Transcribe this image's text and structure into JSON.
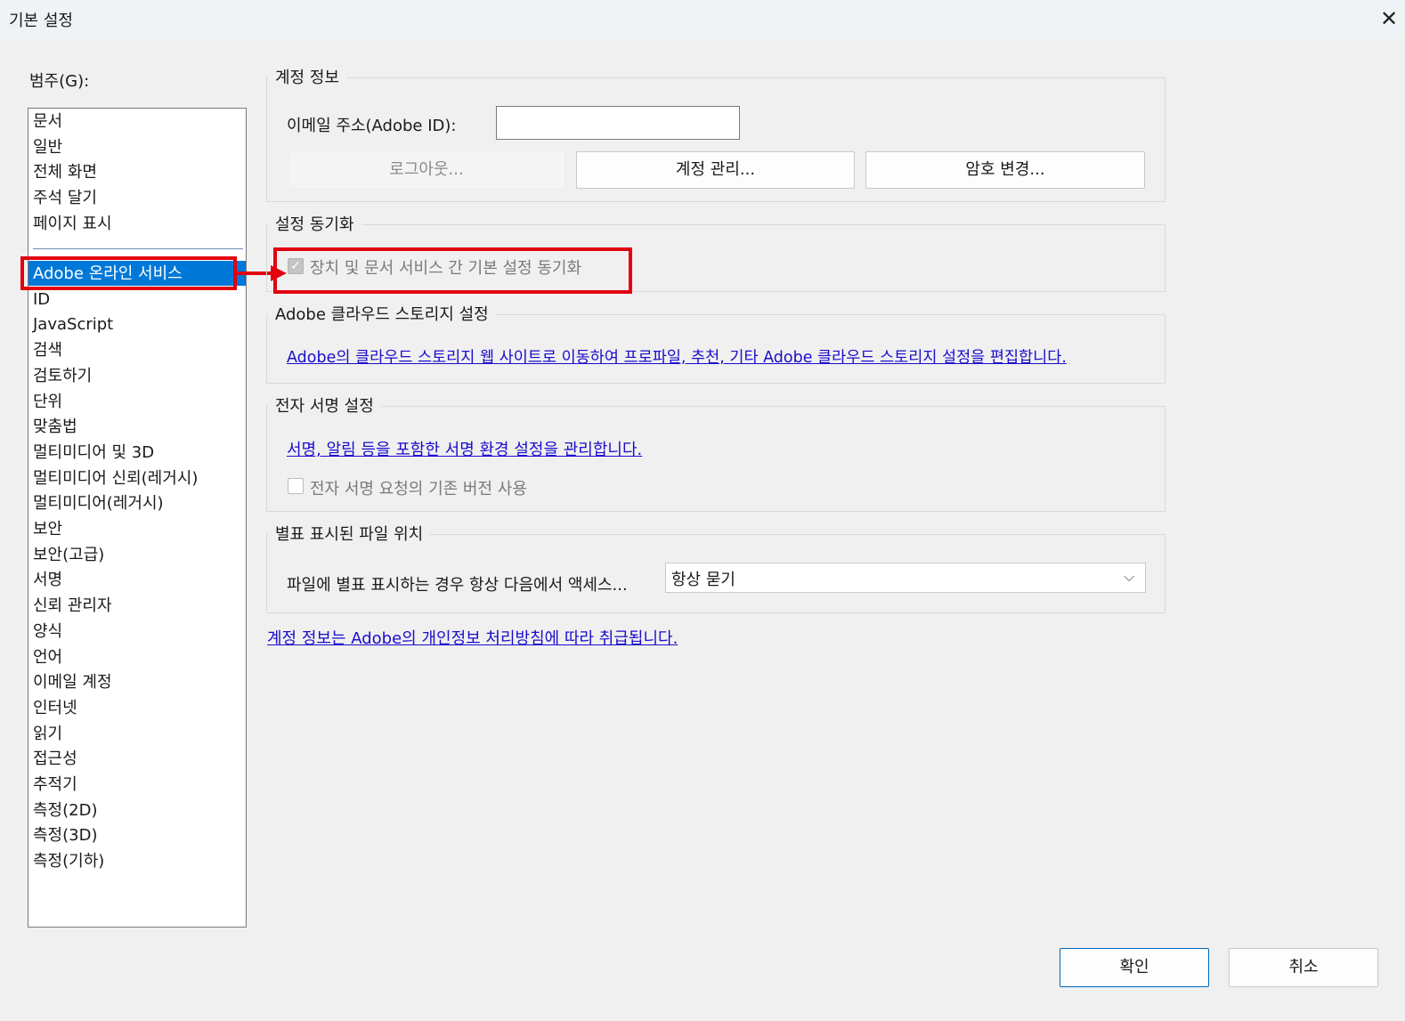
{
  "window": {
    "title": "기본 설정"
  },
  "categories": {
    "label": "범주(G):",
    "group1": [
      "문서",
      "일반",
      "전체 화면",
      "주석 달기",
      "페이지 표시"
    ],
    "group2": [
      "Adobe 온라인 서비스",
      "ID",
      "JavaScript",
      "검색",
      "검토하기",
      "단위",
      "맞춤법",
      "멀티미디어 및 3D",
      "멀티미디어 신뢰(레거시)",
      "멀티미디어(레거시)",
      "보안",
      "보안(고급)",
      "서명",
      "신뢰 관리자",
      "양식",
      "언어",
      "이메일 계정",
      "인터넷",
      "읽기",
      "접근성",
      "추적기",
      "측정(2D)",
      "측정(3D)",
      "측정(기하)"
    ],
    "selected": "Adobe 온라인 서비스"
  },
  "account": {
    "title": "계정 정보",
    "email_label": "이메일 주소(Adobe ID):",
    "email_value": "",
    "logout_label": "로그아웃...",
    "manage_label": "계정 관리...",
    "password_label": "암호 변경..."
  },
  "sync": {
    "title": "설정 동기화",
    "checkbox_label": "장치 및 문서 서비스 간 기본 설정 동기화",
    "checked": true
  },
  "cloud": {
    "title": "Adobe 클라우드 스토리지 설정",
    "link": "Adobe의 클라우드 스토리지 웹 사이트로 이동하여 프로파일, 추천, 기타 Adobe 클라우드 스토리지 설정을 편집합니다."
  },
  "esign": {
    "title": "전자 서명 설정",
    "link": "서명, 알림 등을 포함한 서명 환경 설정을 관리합니다.",
    "checkbox_label": "전자 서명 요청의 기존 버전 사용",
    "checked": false
  },
  "starred": {
    "title": "별표 표시된 파일 위치",
    "label": "파일에 별표 표시하는 경우 항상 다음에서 액세스...",
    "select_value": "항상 묻기"
  },
  "privacy_link": "계정 정보는 Adobe의 개인정보 처리방침에 따라 취급됩니다.",
  "footer": {
    "ok_label": "확인",
    "cancel_label": "취소"
  },
  "colors": {
    "highlight": "#e3000f",
    "selection": "#0078d7",
    "link": "#1a0dcc"
  },
  "icons": {
    "close": "close-icon",
    "dropdown": "chevron-down-icon",
    "check": "check-icon"
  }
}
